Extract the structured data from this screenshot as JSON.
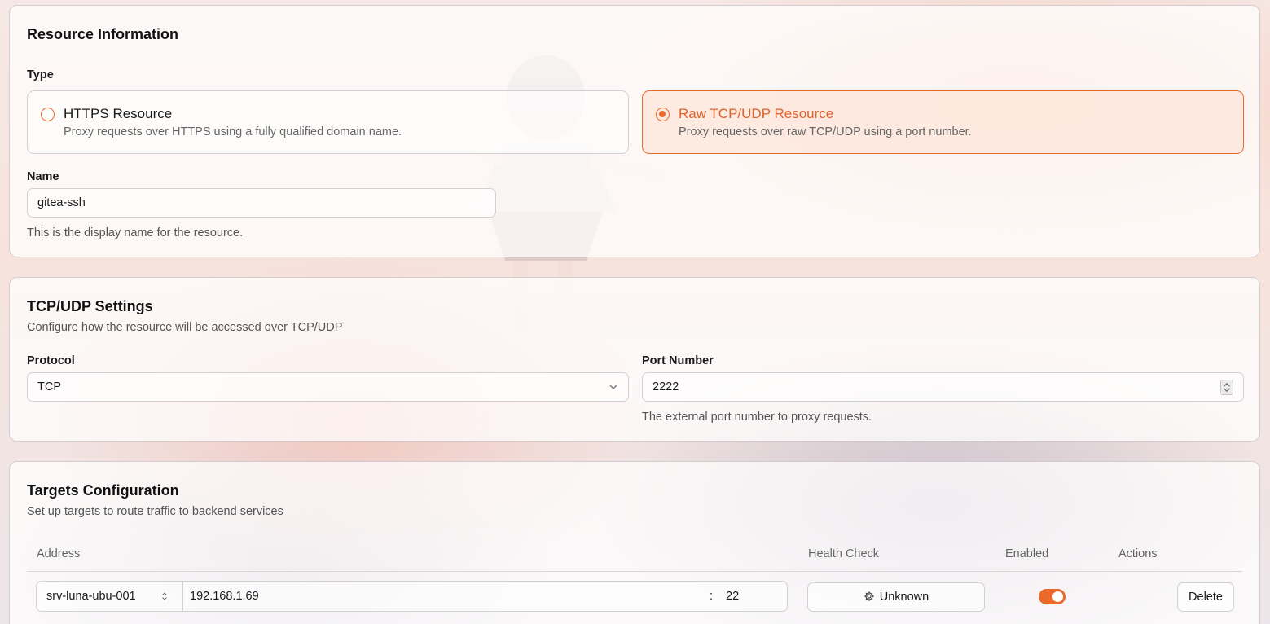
{
  "resource_info": {
    "title": "Resource Information",
    "type_label": "Type",
    "options": [
      {
        "title": "HTTPS Resource",
        "description": "Proxy requests over HTTPS using a fully qualified domain name.",
        "selected": false
      },
      {
        "title": "Raw TCP/UDP Resource",
        "description": "Proxy requests over raw TCP/UDP using a port number.",
        "selected": true
      }
    ],
    "name_label": "Name",
    "name_value": "gitea-ssh",
    "name_helper": "This is the display name for the resource."
  },
  "tcp_udp": {
    "title": "TCP/UDP Settings",
    "description": "Configure how the resource will be accessed over TCP/UDP",
    "protocol_label": "Protocol",
    "protocol_value": "TCP",
    "port_label": "Port Number",
    "port_value": "2222",
    "port_helper": "The external port number to proxy requests."
  },
  "targets": {
    "title": "Targets Configuration",
    "description": "Set up targets to route traffic to backend services",
    "columns": [
      "Address",
      "Health Check",
      "Enabled",
      "Actions"
    ],
    "rows": [
      {
        "site": "srv-luna-ubu-001",
        "ip": "192.168.1.69",
        "separator": ":",
        "port": "22",
        "health": "Unknown",
        "enabled": true,
        "action": "Delete"
      }
    ]
  },
  "colors": {
    "accent": "#ea6a2c"
  },
  "icons": [
    "chevron-down-icon",
    "chevron-updown-icon",
    "gear-icon"
  ]
}
